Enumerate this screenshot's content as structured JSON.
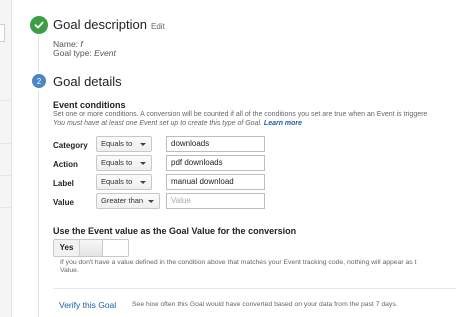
{
  "section1": {
    "title": "Goal description",
    "edit_label": "Edit",
    "name_label": "Name:",
    "name_value": "f",
    "type_label": "Goal type:",
    "type_value": "Event"
  },
  "section2": {
    "step_number": "2",
    "title": "Goal details"
  },
  "event_conditions": {
    "heading": "Event conditions",
    "description": "Set one or more conditions. A conversion will be counted if all of the conditions you set are true when an Event is triggere",
    "requirement": "You must have at least one Event set up to create this type of Goal.",
    "learn_more": "Learn more",
    "rows": [
      {
        "label": "Category",
        "operator": "Equals to",
        "value": "downloads",
        "placeholder": ""
      },
      {
        "label": "Action",
        "operator": "Equals to",
        "value": "pdf downloads",
        "placeholder": ""
      },
      {
        "label": "Label",
        "operator": "Equals to",
        "value": "manual download",
        "placeholder": ""
      },
      {
        "label": "Value",
        "operator": "Greater than",
        "value": "",
        "placeholder": "Value"
      }
    ]
  },
  "use_event_value": {
    "title": "Use the Event value as the Goal Value for the conversion",
    "toggle_label": "Yes",
    "info_line1": "If you don't have a value defined in the condition above that matches your Event tracking code, nothing will appear as t",
    "info_line2": "Value."
  },
  "verify": {
    "link_label": "Verify this Goal",
    "description": "See how often this Goal would have converted based on your data from the past 7 days."
  },
  "colors": {
    "check_green": "#3d9f45",
    "step_blue": "#4a86c5",
    "link_blue": "#1a5fa8"
  }
}
